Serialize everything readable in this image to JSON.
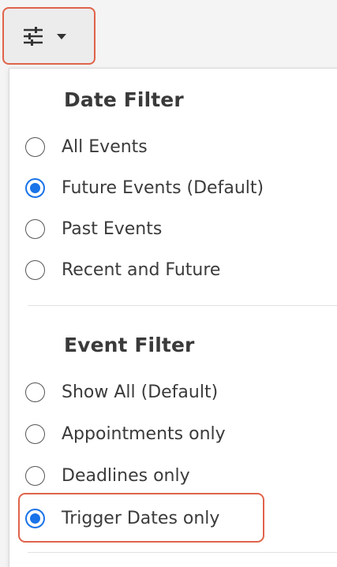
{
  "toolbar": {
    "filter_button_icon": "sliders-icon",
    "caret_icon": "caret-down-icon",
    "highlight_color": "#e0634b"
  },
  "date_filter": {
    "title": "Date Filter",
    "options": [
      {
        "label": "All Events",
        "checked": false
      },
      {
        "label": "Future Events (Default)",
        "checked": true
      },
      {
        "label": "Past Events",
        "checked": false
      },
      {
        "label": "Recent and Future",
        "checked": false
      }
    ]
  },
  "event_filter": {
    "title": "Event Filter",
    "options": [
      {
        "label": "Show All (Default)",
        "checked": false
      },
      {
        "label": "Appointments only",
        "checked": false
      },
      {
        "label": "Deadlines only",
        "checked": false
      },
      {
        "label": "Trigger Dates only",
        "checked": true
      }
    ]
  },
  "colors": {
    "radio_selected": "#1a73e8",
    "text": "#3b3b3b"
  }
}
